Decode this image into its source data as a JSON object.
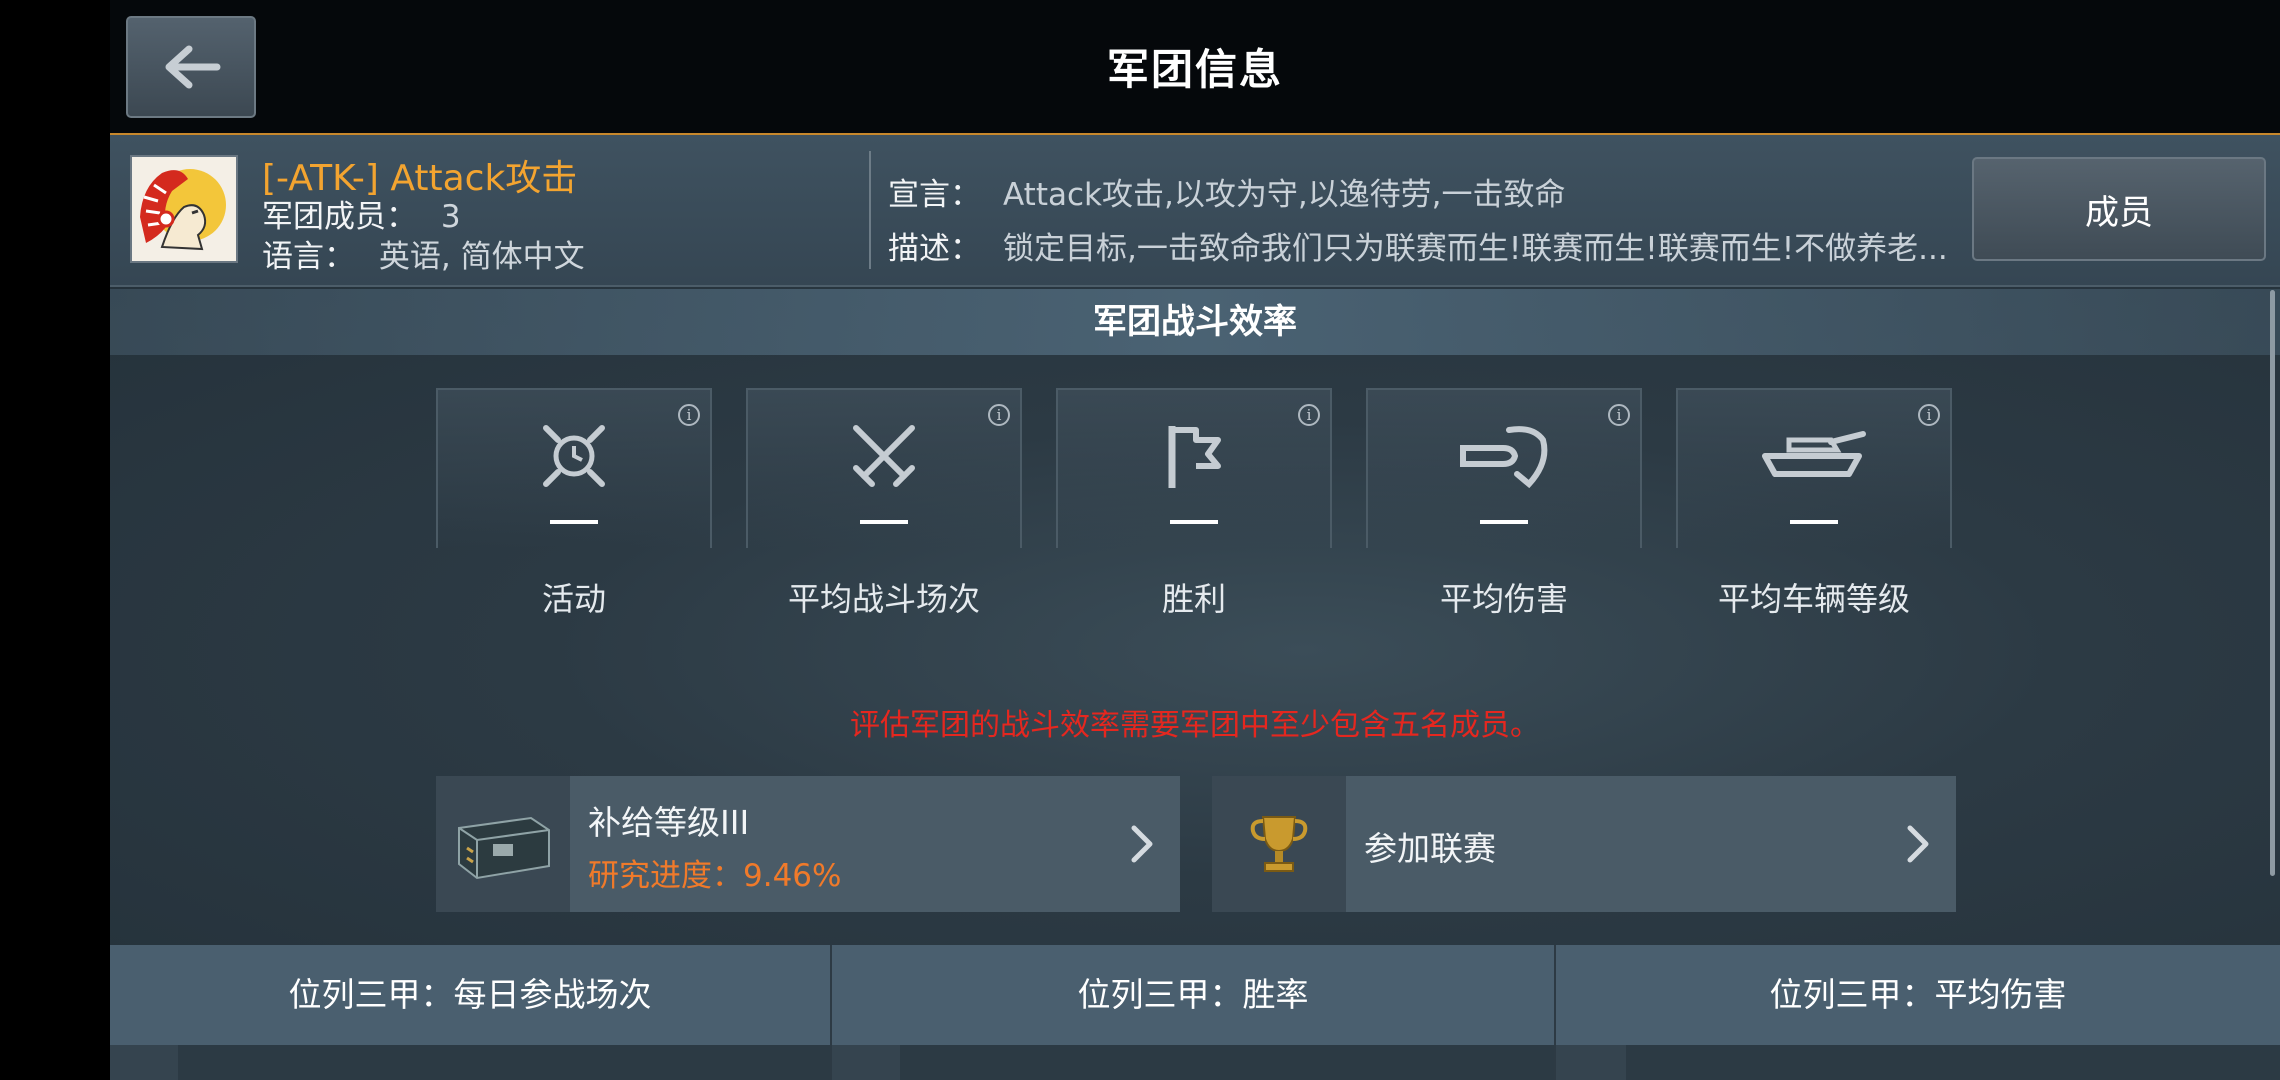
{
  "header": {
    "title": "军团信息"
  },
  "clan": {
    "name": "[-ATK-] Attack攻击",
    "members_label": "军团成员：",
    "members_value": "3",
    "language_label": "语言：",
    "language_value": "英语, 简体中文",
    "motto_label": "宣言：",
    "motto_value": "Attack攻击,以攻为守,以逸待劳,一击致命",
    "description_label": "描述：",
    "description_value": "锁定目标,一击致命我们只为联赛而生!联赛而生!联赛而生!不做养老...",
    "members_button": "成员"
  },
  "efficiency": {
    "title": "军团战斗效率",
    "stats": [
      {
        "label": "活动",
        "value": "—",
        "icon": "alarm-clock-icon"
      },
      {
        "label": "平均战斗场次",
        "value": "—",
        "icon": "crossed-swords-icon"
      },
      {
        "label": "胜利",
        "value": "—",
        "icon": "flag-icon"
      },
      {
        "label": "平均伤害",
        "value": "—",
        "icon": "shell-hit-icon"
      },
      {
        "label": "平均车辆等级",
        "value": "—",
        "icon": "tank-icon"
      }
    ],
    "info_symbol": "i",
    "warning": "评估军团的战斗效率需要军团中至少包含五名成员。"
  },
  "supply": {
    "title": "补给等级III",
    "progress_label": "研究进度：",
    "progress_value": "9.46%"
  },
  "league": {
    "title": "参加联赛"
  },
  "top3_tabs": [
    {
      "label": "位列三甲：每日参战场次"
    },
    {
      "label": "位列三甲：胜率"
    },
    {
      "label": "位列三甲：平均伤害"
    }
  ],
  "colors": {
    "accent_orange": "#f3a430",
    "warning_red": "#e5271f",
    "progress_orange": "#f07a2a"
  }
}
